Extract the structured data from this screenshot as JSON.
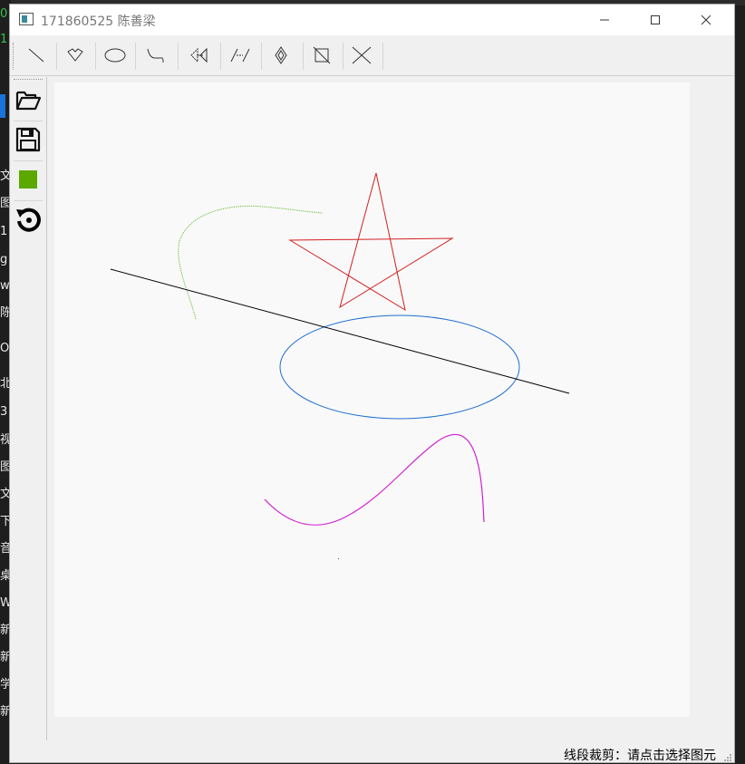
{
  "window": {
    "title": "171860525 陈善梁"
  },
  "toolbar": {
    "tools": [
      {
        "name": "line-tool-button"
      },
      {
        "name": "polygon-tool-button"
      },
      {
        "name": "ellipse-tool-button"
      },
      {
        "name": "curve-tool-button"
      },
      {
        "name": "translate-tool-button"
      },
      {
        "name": "rotate-tool-button"
      },
      {
        "name": "scale-tool-button"
      },
      {
        "name": "clip-tool-button"
      },
      {
        "name": "delete-tool-button"
      }
    ]
  },
  "sidebar": {
    "tools": [
      "open-file-button",
      "save-file-button",
      "color-picker-button",
      "reset-canvas-button"
    ],
    "current_color": "#5aa800"
  },
  "canvas": {
    "shapes": [
      {
        "type": "line",
        "color": "#000000"
      },
      {
        "type": "polygon-star",
        "color": "#d42020"
      },
      {
        "type": "ellipse",
        "color": "#1f6fd0"
      },
      {
        "type": "curve",
        "color": "#5fb830"
      },
      {
        "type": "curve",
        "color": "#d020d0"
      }
    ]
  },
  "status": {
    "text": "线段裁剪：请点击选择图元"
  },
  "background_app": {
    "chars": [
      "0",
      "1",
      "文",
      "图",
      "1",
      "g",
      "w",
      "陈",
      "O",
      "北",
      "3",
      "视",
      "图",
      "文",
      "下",
      "音",
      "桌",
      "W",
      "新",
      "新",
      "学",
      "新"
    ]
  }
}
